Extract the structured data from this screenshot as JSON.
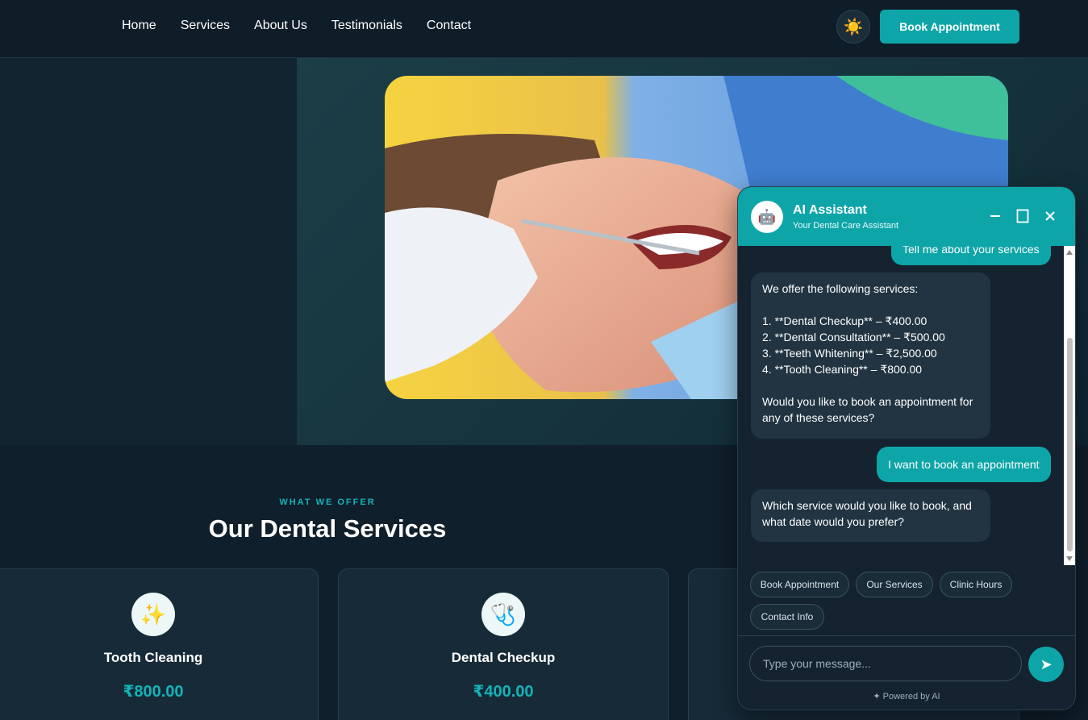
{
  "nav": {
    "links": [
      "Home",
      "Services",
      "About Us",
      "Testimonials",
      "Contact"
    ],
    "theme_icon": "sun-icon",
    "book_label": "Book Appointment"
  },
  "services": {
    "eyebrow": "WHAT WE OFFER",
    "title": "Our Dental Services",
    "cards": [
      {
        "icon": "sparkles-icon",
        "glyph": "✨",
        "title": "Tooth Cleaning",
        "price": "₹800.00"
      },
      {
        "icon": "stethoscope-icon",
        "glyph": "🩺",
        "title": "Dental Checkup",
        "price": "₹400.00"
      }
    ]
  },
  "chat": {
    "title": "AI Assistant",
    "subtitle": "Your Dental Care Assistant",
    "messages": [
      {
        "role": "user",
        "text": "Tell me about your services"
      },
      {
        "role": "bot",
        "text": "We offer the following services:\n\n1. **Dental Checkup** – ₹400.00\n2. **Dental Consultation** – ₹500.00\n3. **Teeth Whitening** – ₹2,500.00\n4. **Tooth Cleaning** – ₹800.00\n\nWould you like to book an appointment for any of these services?"
      },
      {
        "role": "user",
        "text": "I want to book an appointment"
      },
      {
        "role": "bot",
        "text": "Which service would you like to book, and what date would you prefer?"
      }
    ],
    "quick_replies": [
      "Book Appointment",
      "Our Services",
      "Clinic Hours",
      "Contact Info"
    ],
    "input_placeholder": "Type your message...",
    "powered_by": "✦ Powered by AI"
  },
  "colors": {
    "accent": "#0ea5a8",
    "background": "#0f1f2b",
    "bubble_bot": "#223441"
  }
}
